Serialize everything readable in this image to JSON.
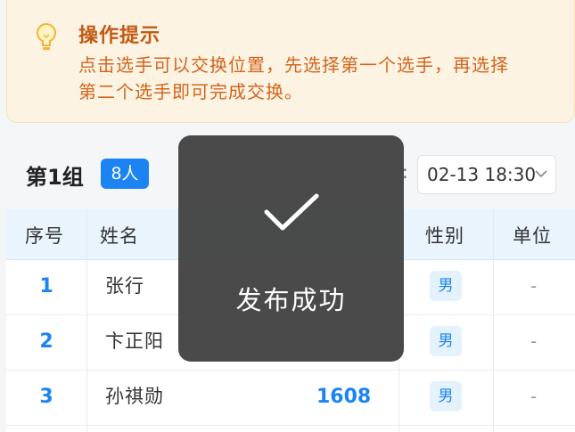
{
  "tip": {
    "icon": "lightbulb-icon",
    "title": "操作提示",
    "line1": "点击选手可以交换位置，先选择第一个选手，再选择",
    "line2": "第二个选手即可完成交换。"
  },
  "group": {
    "title": "第1组",
    "count": "8人",
    "colon": ":",
    "datetime": "02-13 18:30",
    "dropdown_icon": "chevron-down-icon"
  },
  "table": {
    "headers": {
      "index": "序号",
      "name": "姓名",
      "gender": "性别",
      "unit": "单位"
    },
    "rows": [
      {
        "index": "1",
        "name": "张行",
        "score": "",
        "gender": "男",
        "unit": "-"
      },
      {
        "index": "2",
        "name": "卞正阳",
        "score": "",
        "gender": "男",
        "unit": "-"
      },
      {
        "index": "3",
        "name": "孙祺勋",
        "score": "1608",
        "gender": "男",
        "unit": "-"
      }
    ]
  },
  "toast": {
    "icon": "checkmark-icon",
    "text": "发布成功"
  },
  "colors": {
    "accent": "#1b84f2",
    "tip_text": "#d3651c",
    "tip_bg": "#fdf3e3",
    "toast_bg": "#3c3c3c"
  }
}
